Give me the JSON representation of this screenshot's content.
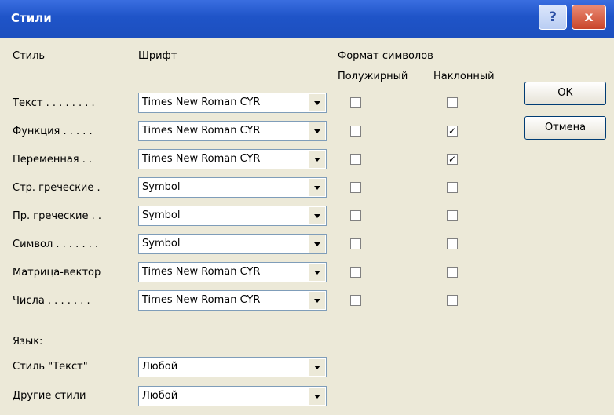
{
  "window": {
    "title": "Стили",
    "help_label": "?",
    "close_label": "x"
  },
  "headers": {
    "style": "Стиль",
    "font": "Шрифт",
    "format": "Формат символов",
    "bold": "Полужирный",
    "italic": "Наклонный"
  },
  "rows": [
    {
      "style": "Текст . . . . . . . .",
      "font": "Times New Roman CYR",
      "bold": false,
      "italic": false
    },
    {
      "style": "Функция . . . . .",
      "font": "Times New Roman CYR",
      "bold": false,
      "italic": true
    },
    {
      "style": "Переменная . .",
      "font": "Times New Roman CYR",
      "bold": false,
      "italic": true
    },
    {
      "style": "Стр. греческие .",
      "font": "Symbol",
      "bold": false,
      "italic": false
    },
    {
      "style": "Пр. греческие . .",
      "font": "Symbol",
      "bold": false,
      "italic": false
    },
    {
      "style": "Символ . . . . . . .",
      "font": "Symbol",
      "bold": false,
      "italic": false
    },
    {
      "style": "Матрица-вектор",
      "font": "Times New Roman CYR",
      "bold": false,
      "italic": false
    },
    {
      "style": "Числа . . . . . . .",
      "font": "Times New Roman CYR",
      "bold": false,
      "italic": false
    }
  ],
  "language": {
    "heading": "Язык:",
    "text_style_label": "Стиль \"Текст\"",
    "text_style_value": "Любой",
    "other_styles_label": "Другие стили",
    "other_styles_value": "Любой"
  },
  "buttons": {
    "ok": "ОК",
    "cancel": "Отмена"
  },
  "colors": {
    "titlebar": "#1f54c8",
    "background": "#ece9d8"
  }
}
